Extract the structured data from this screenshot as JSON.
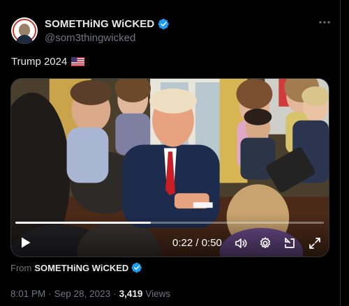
{
  "tweet": {
    "display_name": "SOMETHiNG WiCKED",
    "handle": "@som3thingwicked",
    "text": "Trump 2024",
    "flag_icon": "us-flag-icon"
  },
  "video": {
    "time_display": "0:22 / 0:50",
    "progress": 0.44
  },
  "source": {
    "prefix": "From",
    "name": "SOMETHiNG WiCKED"
  },
  "meta": {
    "time": "8:01 PM",
    "separator": "·",
    "date": "Sep 28, 2023",
    "views_count": "3,419",
    "views_label": "Views"
  },
  "colors": {
    "verified": "#1d9bf0",
    "background": "#000000",
    "secondary_text": "#71767b"
  }
}
